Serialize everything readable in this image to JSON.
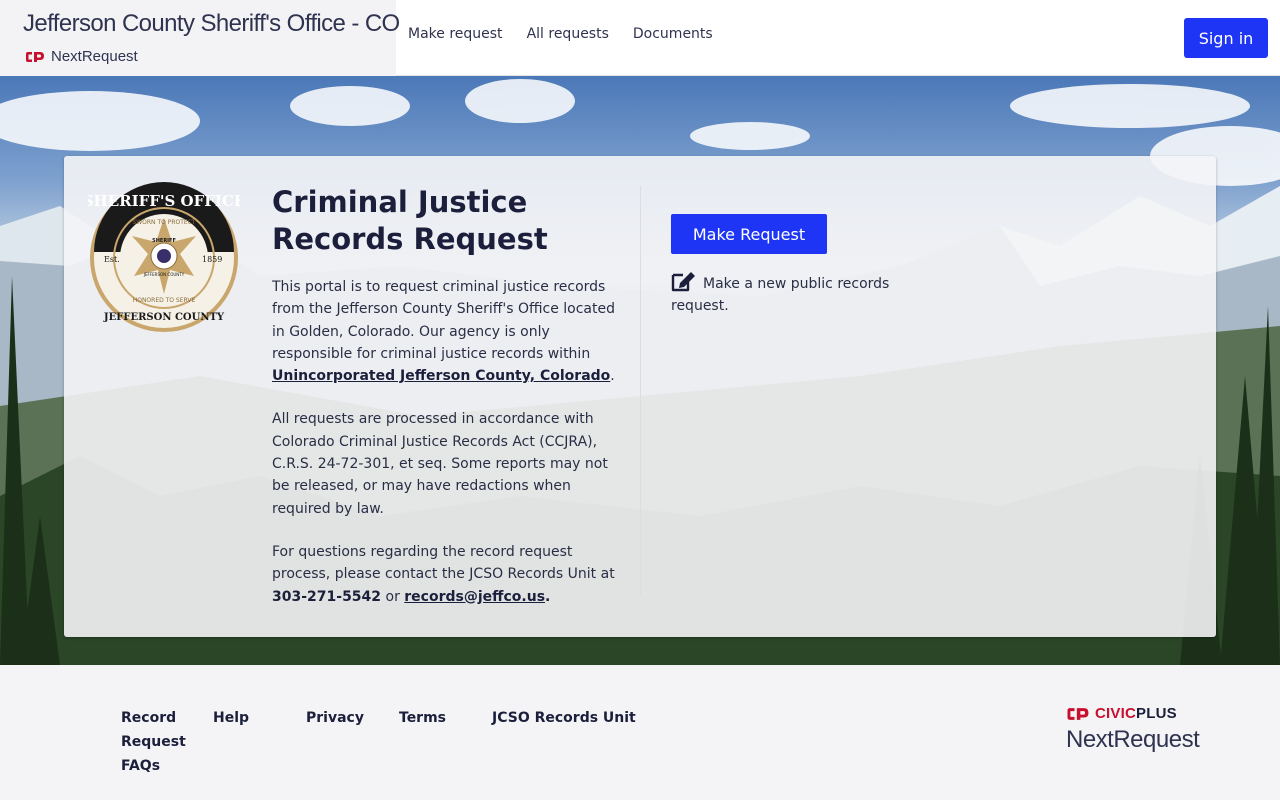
{
  "header": {
    "site_title": "Jefferson County Sheriff's Office - CO",
    "brand_name": "NextRequest",
    "nav": [
      "Make request",
      "All requests",
      "Documents"
    ],
    "signin_label": "Sign in"
  },
  "hero": {
    "seal": {
      "text_top": "SHERIFF'S OFFICE",
      "text_inner_top": "SWORN TO PROTECT",
      "text_inner_bottom": "HONORED TO SERVE",
      "text_bottom": "JEFFERSON COUNTY",
      "est": "Est.",
      "year": "1859",
      "badge_top": "SHERIFF",
      "badge_bottom": "JEFFERSON COUNTY"
    },
    "title": "Criminal Justice Records Request",
    "p1_text": "This portal is to request criminal justice records from the Jefferson County Sheriff's Office located in Golden, Colorado. Our agency is only responsible for criminal justice records within ",
    "p1_link": "Unincorporated Jefferson County, Colorado",
    "p1_end": ".",
    "p2": "All requests are processed in accordance with Colorado Criminal Justice Records Act (CCJRA), C.R.S. 24-72-301, et seq. Some reports may not be released, or may have redactions when required by law.",
    "p3_text": "For questions regarding the record request process, please contact the JCSO Records Unit at ",
    "p3_phone": "303-271-5542",
    "p3_or": " or ",
    "p3_email": "records@jeffco.us",
    "p3_end": ".",
    "make_button": "Make Request",
    "make_desc": "Make a new public records request."
  },
  "footer": {
    "links": [
      "Record Request FAQs",
      "Help",
      "Privacy",
      "Terms",
      "JCSO Records Unit"
    ],
    "civic_word": "CIVIC",
    "civic_plus": "PLUS",
    "civic_next": "NextRequest"
  },
  "colors": {
    "accent": "#1f35f5",
    "civic_red": "#c8102e",
    "text_dark": "#1b1f3b"
  }
}
